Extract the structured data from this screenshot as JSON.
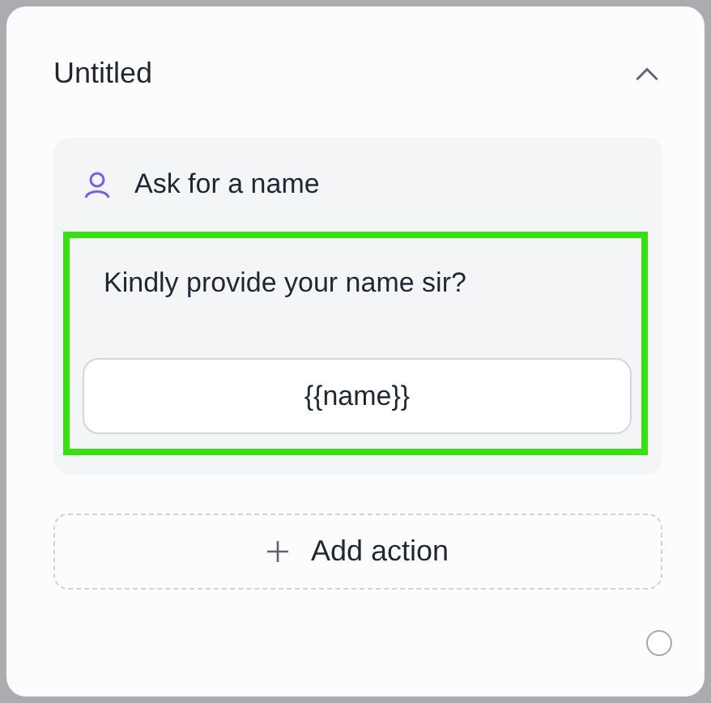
{
  "card": {
    "title": "Untitled",
    "expanded": true
  },
  "step": {
    "title": "Ask for a name",
    "message": {
      "text": "Kindly provide your name sir?",
      "selected": true,
      "reply": "{{name}}"
    }
  },
  "add_action": {
    "label": "Add action"
  }
}
